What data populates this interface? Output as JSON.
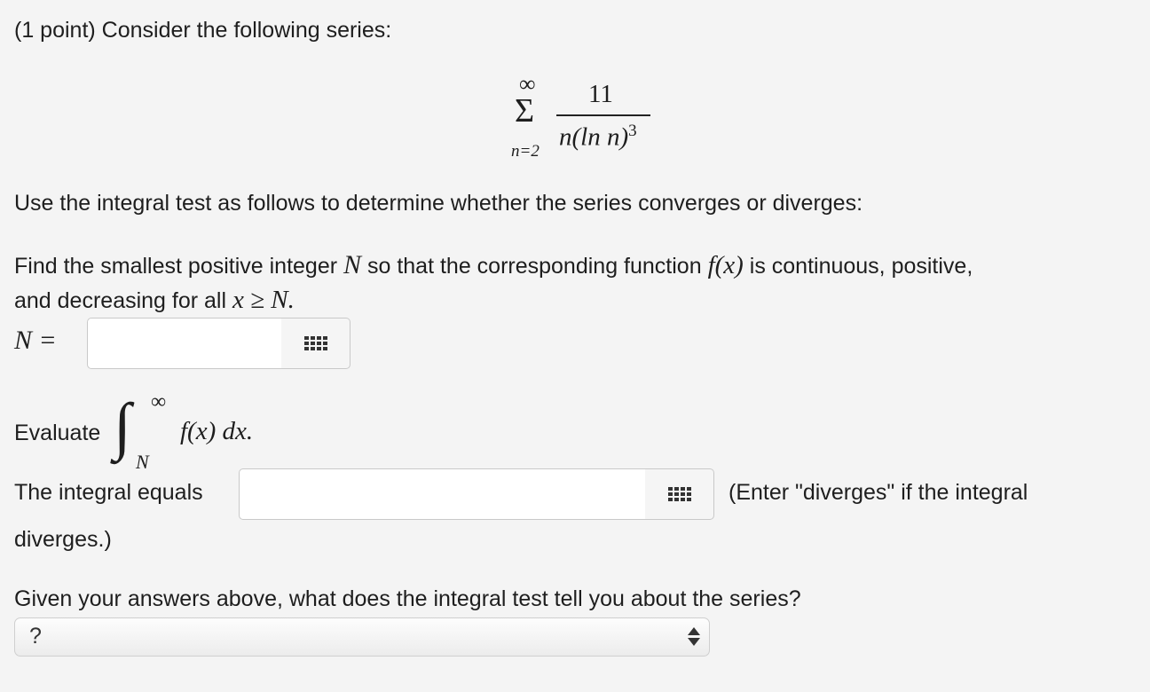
{
  "problem": {
    "header": "(1 point) Consider the following series:",
    "series": {
      "sum_symbol": "Σ",
      "upper_limit": "∞",
      "lower_limit": "n=2",
      "numerator": "11",
      "denom_prefix": "n(ln n)",
      "denom_exponent": "3"
    },
    "instruction": "Use the integral test as follows to determine whether the series converges or diverges:",
    "find_line1_a": "Find the smallest positive integer ",
    "find_line1_var": "N",
    "find_line1_b": " so that the corresponding function ",
    "find_line1_func": "f(x)",
    "find_line1_c": " is continuous, positive,",
    "find_line2_a": "and decreasing for all ",
    "find_line2_math": "x ≥ N.",
    "n_label": "N =",
    "evaluate_label": "Evaluate",
    "integral_symbol": "∫",
    "integral_upper": "∞",
    "integral_lower": "N",
    "integrand": "f(x) dx.",
    "integral_equals_label": "The integral equals",
    "diverges_hint_a": "(Enter \"diverges\" if the integral",
    "diverges_hint_b": "diverges.)",
    "question": "Given your answers above, what does the integral test tell you about the series?",
    "select_value": "?"
  },
  "inputs": {
    "n_value": "",
    "integral_value": ""
  }
}
